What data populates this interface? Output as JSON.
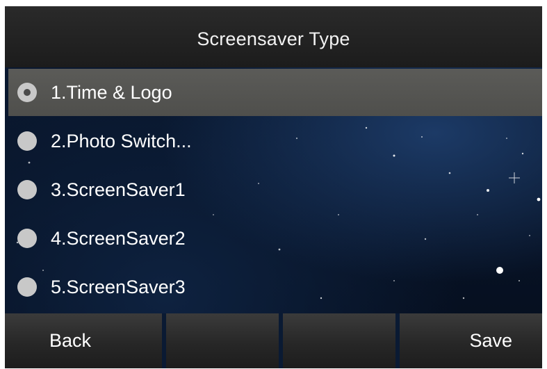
{
  "header": {
    "title": "Screensaver Type"
  },
  "options": [
    {
      "label": "1.Time & Logo",
      "selected": true
    },
    {
      "label": "2.Photo Switch...",
      "selected": false
    },
    {
      "label": "3.ScreenSaver1",
      "selected": false
    },
    {
      "label": "4.ScreenSaver2",
      "selected": false
    },
    {
      "label": "5.ScreenSaver3",
      "selected": false
    }
  ],
  "softkeys": {
    "key1": "Back",
    "key2": "",
    "key3": "",
    "key4": "Save"
  },
  "colors": {
    "selected_row": "#555552",
    "radio": "#c8c8c8",
    "titlebar": "#222222",
    "background": "#0a1a33"
  }
}
